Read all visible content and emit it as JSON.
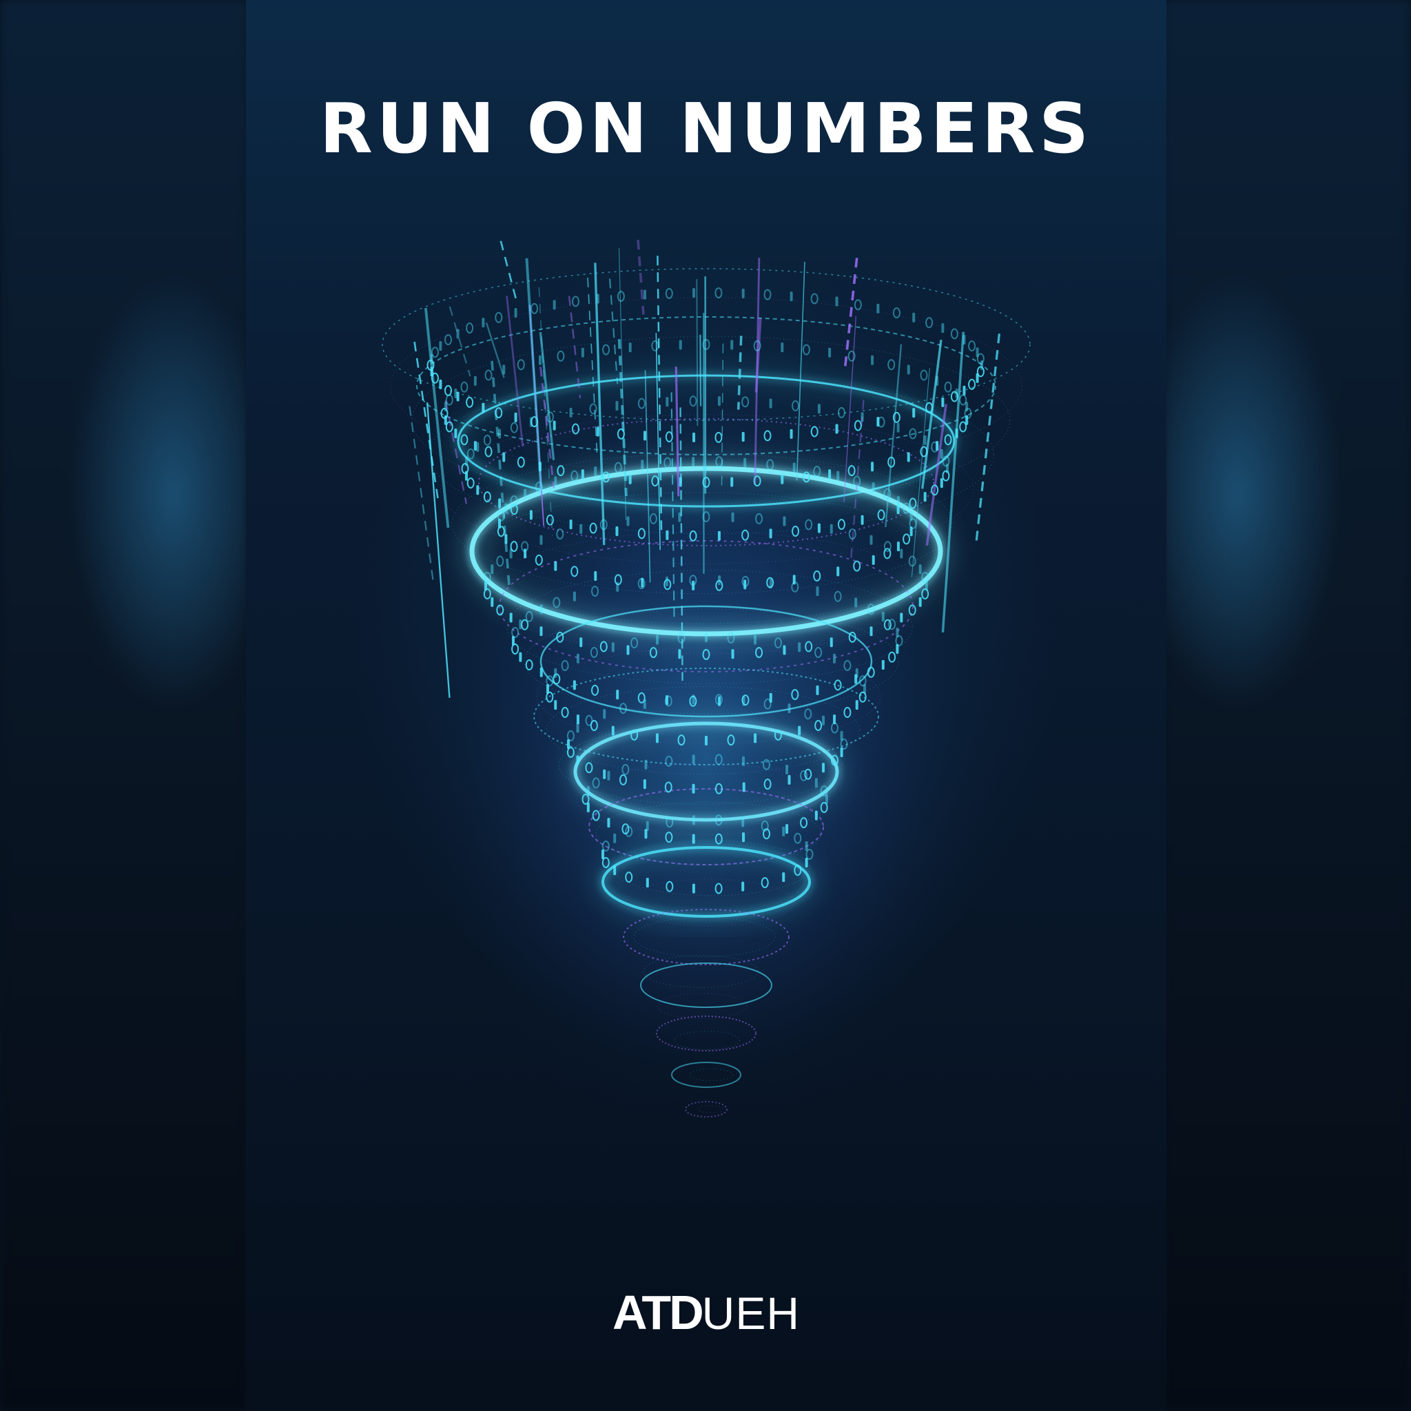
{
  "poster": {
    "title": "RUN ON NUMBERS",
    "logo_strong": "ATD",
    "logo_light": "UEH"
  },
  "colors": {
    "background": "#0a1c33",
    "cyan_glow": "#4ee6ff",
    "violet_glow": "#a070ff",
    "text": "#ffffff"
  },
  "illustration": {
    "subject": "funnel-of-binary-digits-icon"
  }
}
